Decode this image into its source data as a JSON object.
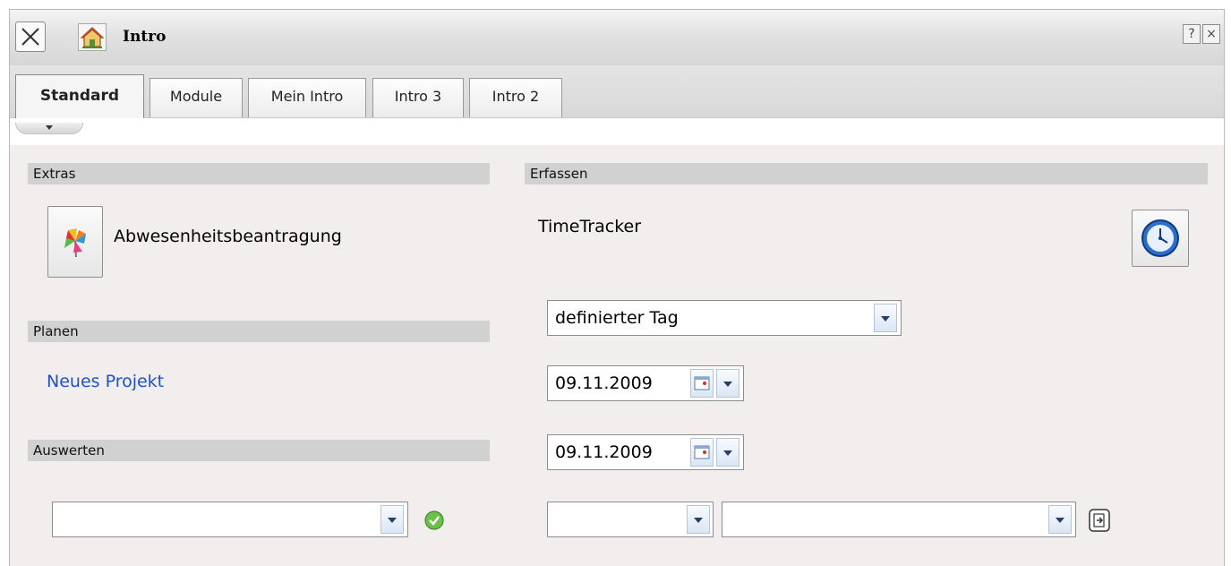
{
  "window": {
    "title": "Intro",
    "help_label": "?",
    "close_label": "×",
    "icons": {
      "close": "close-x-icon",
      "home": "home-icon"
    }
  },
  "tabs": [
    {
      "label": "Standard",
      "active": true
    },
    {
      "label": "Module",
      "active": false
    },
    {
      "label": "Mein Intro",
      "active": false
    },
    {
      "label": "Intro 3",
      "active": false
    },
    {
      "label": "Intro 2",
      "active": false
    }
  ],
  "sections": {
    "extras": {
      "header": "Extras",
      "item_label": "Abwesenheitsbeantragung",
      "item_icon": "pinwheel-icon"
    },
    "planen": {
      "header": "Planen",
      "link": "Neues Projekt"
    },
    "auswerten": {
      "header": "Auswerten",
      "select_value": "",
      "confirm_icon": "check-circle-icon"
    },
    "erfassen": {
      "header": "Erfassen",
      "tracker_label": "TimeTracker",
      "tracker_icon": "clock-icon",
      "mode_select": "definierter Tag",
      "date_from": "09.11.2009",
      "date_to": "09.11.2009",
      "select_a": "",
      "select_b": "",
      "submit_icon": "export-icon"
    }
  },
  "colors": {
    "content_bg": "#f1eeed",
    "section_header_bg": "#d1d1d1",
    "link": "#2250c8",
    "dropdown_arrow": "#27406a"
  }
}
